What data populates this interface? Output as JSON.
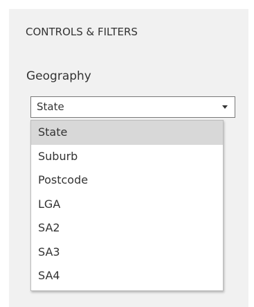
{
  "panel": {
    "title": "CONTROLS & FILTERS"
  },
  "filter": {
    "label": "Geography",
    "selected_value": "State",
    "options": [
      "State",
      "Suburb",
      "Postcode",
      "LGA",
      "SA2",
      "SA3",
      "SA4"
    ],
    "highlighted_index": 0
  },
  "icons": {
    "caret": "chevron-down-icon"
  }
}
